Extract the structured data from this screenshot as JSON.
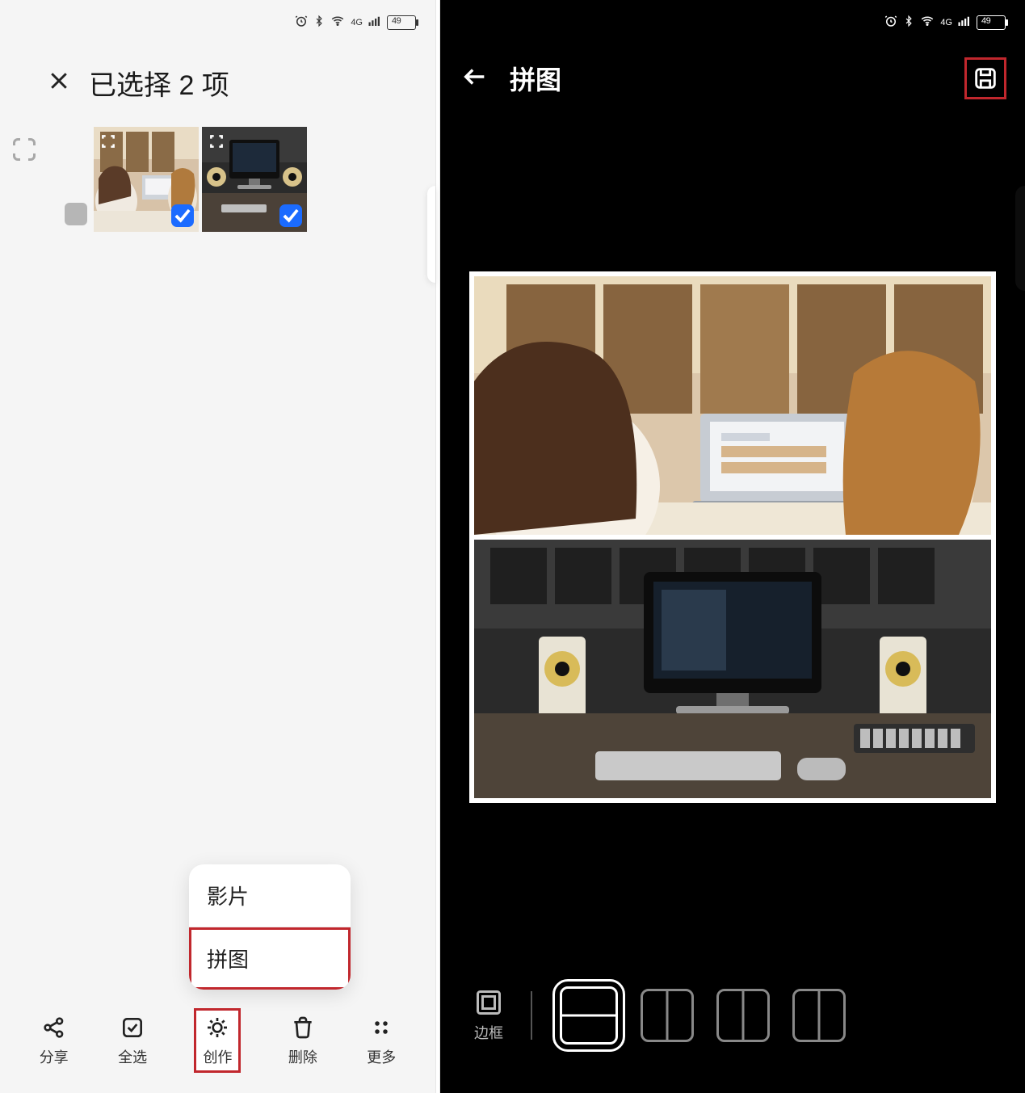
{
  "status": {
    "battery": "49",
    "network_label": "4G",
    "icons": [
      "alarm-icon",
      "bluetooth-icon",
      "wifi-icon",
      "signal-icon",
      "battery-icon"
    ]
  },
  "left": {
    "title": "已选择 2 项",
    "thumbnails": [
      {
        "name": "photo-people-laptop",
        "selected": true
      },
      {
        "name": "photo-desk-monitor",
        "selected": true
      }
    ],
    "popup": {
      "items": [
        {
          "label": "影片",
          "highlight": false
        },
        {
          "label": "拼图",
          "highlight": true
        }
      ]
    },
    "bottom": [
      {
        "icon": "share-icon",
        "label": "分享"
      },
      {
        "icon": "select-all-icon",
        "label": "全选"
      },
      {
        "icon": "create-icon",
        "label": "创作",
        "highlight": true
      },
      {
        "icon": "delete-icon",
        "label": "删除"
      },
      {
        "icon": "more-icon",
        "label": "更多"
      }
    ]
  },
  "right": {
    "title": "拼图",
    "save_highlight": true,
    "frame_label": "边框",
    "layouts": [
      {
        "type": "h2",
        "active": true
      },
      {
        "type": "v2",
        "active": false
      },
      {
        "type": "v2",
        "active": false
      },
      {
        "type": "v2b",
        "active": false
      }
    ],
    "collage_slots": [
      "photo-people-laptop",
      "photo-desk-monitor"
    ]
  }
}
